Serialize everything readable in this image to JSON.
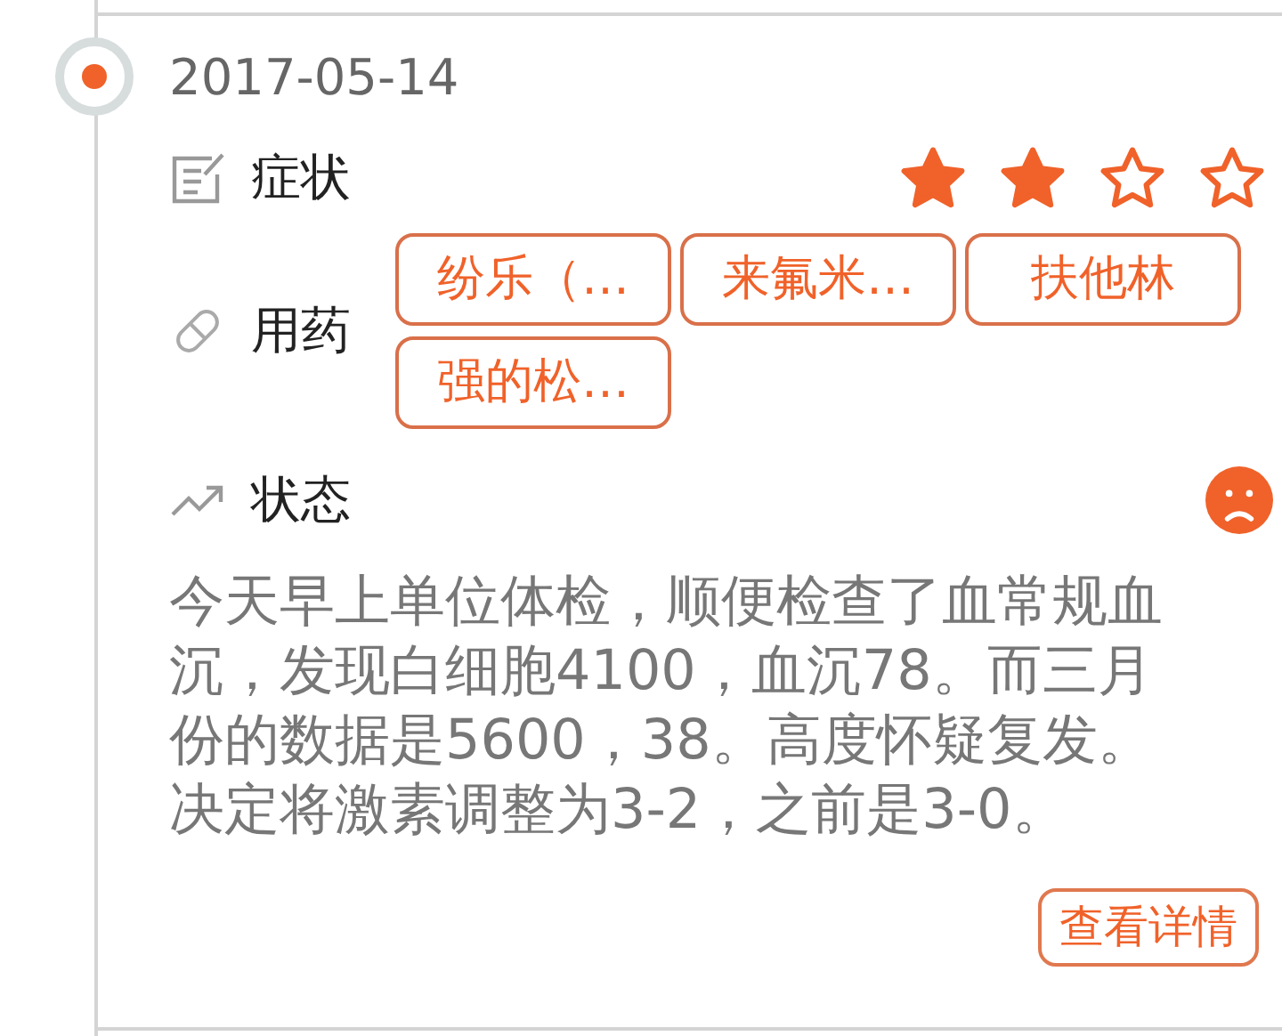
{
  "entry": {
    "date": "2017-05-14",
    "selected": true,
    "symptoms": {
      "label": "症状",
      "stars": 2
    },
    "medication": {
      "label": "用药",
      "tags": [
        "纷乐（…",
        "来氟米…",
        "扶他林",
        "强的松…"
      ]
    },
    "status": {
      "label": "状态",
      "sad": true,
      "note": "今天早上单位体检，顺便检查了血常规血沉，发现白细胞4100，血沉78。而三月份的数据是5600，38。高度怀疑复发。决定将激素调整为3-2，之前是3-0。"
    },
    "details_button": "查看详情"
  }
}
